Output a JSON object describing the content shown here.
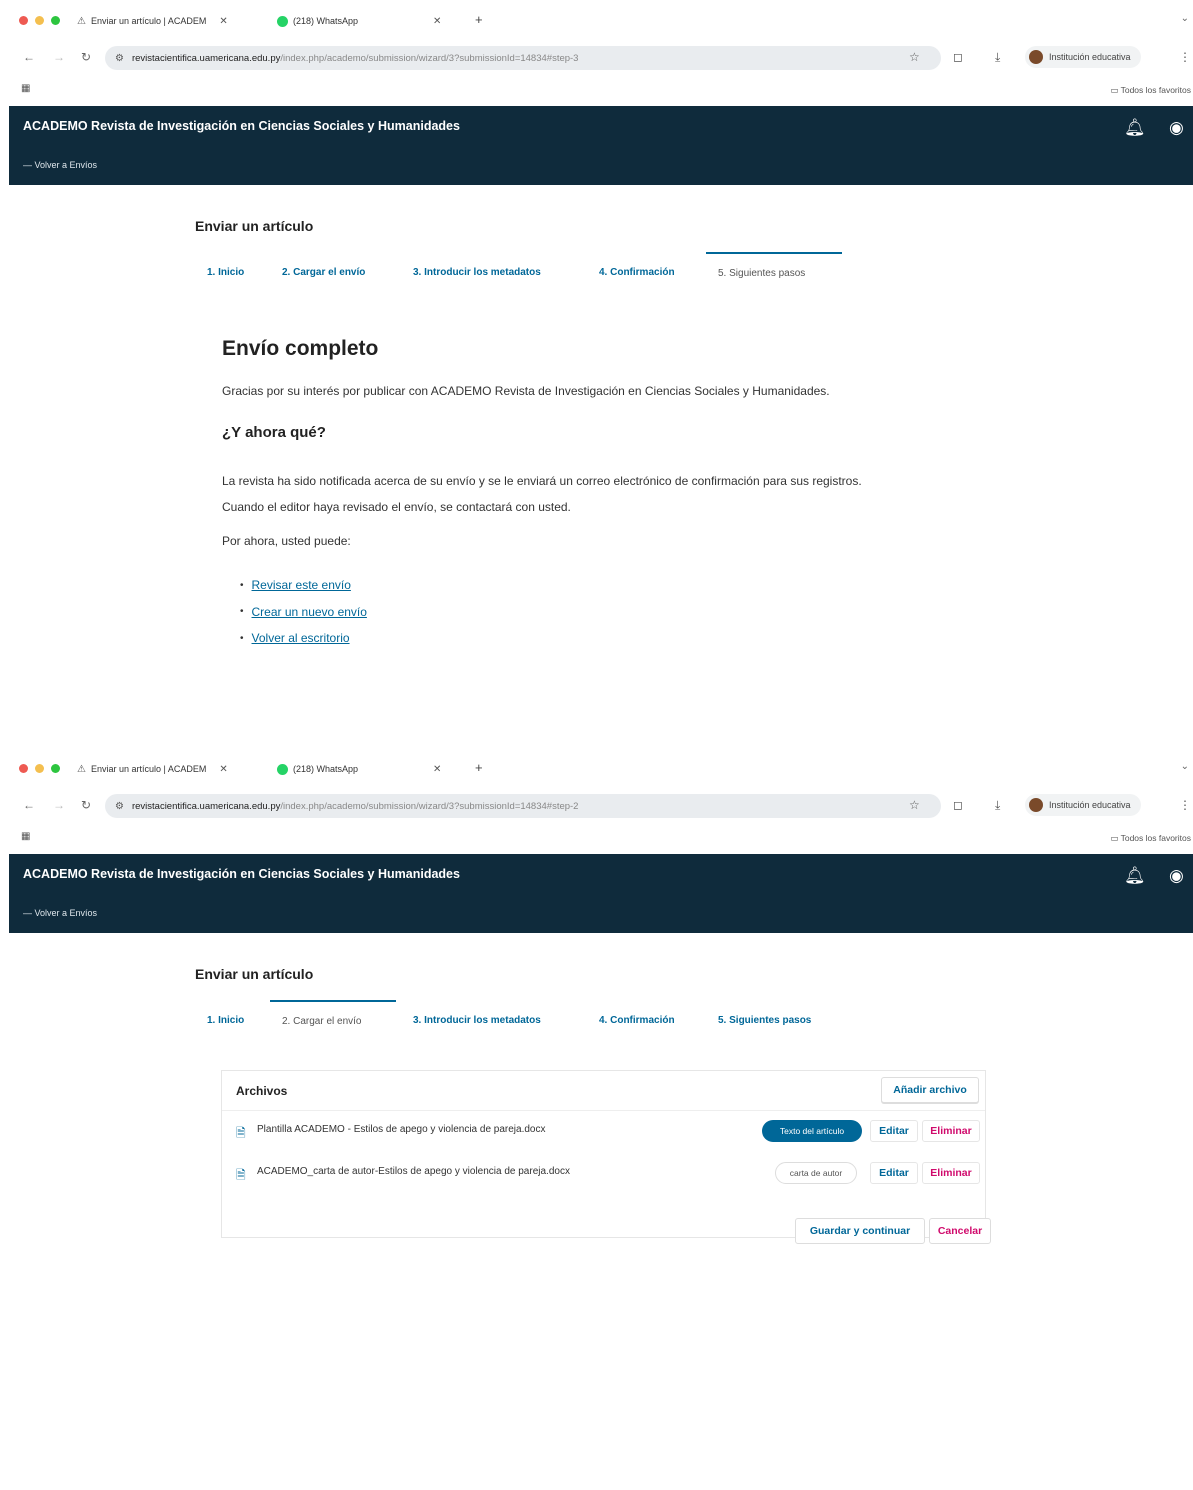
{
  "browser": {
    "tab_active_label": "Enviar un artículo | ACADEM",
    "tab_other_label": "(218) WhatsApp",
    "tab_active_label_2": "Enviar un artículo | ACADEM",
    "tab_other_label_2": "(218) WhatsApp",
    "url_host": "revistacientifica.uamericana.edu.py",
    "url_path_1": "/index.php/academo/submission/wizard/3?submissionId=14834#step-3",
    "url_path_2": "/index.php/academo/submission/wizard/3?submissionId=14834#step-2",
    "profile_label": "Institución educativa",
    "bookmarks_all": "Todos los favoritos"
  },
  "site": {
    "title": "ACADEMO Revista de Investigación en Ciencias Sociales y Humanidades",
    "back_link": "— Volver a Envíos"
  },
  "wizard": {
    "page_title": "Enviar un artículo",
    "tabs": [
      {
        "label": "1. Inicio"
      },
      {
        "label": "2. Cargar el envío"
      },
      {
        "label": "3. Introducir los metadatos"
      },
      {
        "label": "4. Confirmación"
      },
      {
        "label": "5. Siguientes pasos"
      }
    ]
  },
  "complete": {
    "heading": "Envío completo",
    "thanks": "Gracias por su interés por publicar con ACADEMO Revista de Investigación en Ciencias Sociales y Humanidades.",
    "subheading": "¿Y ahora qué?",
    "notified_line1": "La revista ha sido notificada acerca de su envío y se le enviará un correo electrónico de confirmación para sus registros.",
    "notified_line2": "Cuando el editor haya revisado el envío, se contactará con usted.",
    "for_now": "Por ahora, usted puede:",
    "links": [
      "Revisar este envío",
      "Crear un nuevo envío",
      "Volver al escritorio"
    ]
  },
  "upload": {
    "files_title": "Archivos",
    "add_file": "Añadir archivo",
    "files": [
      {
        "name": "Plantilla ACADEMO - Estilos de apego y violencia de pareja.docx",
        "type": "Texto del artículo"
      },
      {
        "name": "ACADEMO_carta de autor-Estilos de apego y violencia de pareja.docx",
        "type": "carta de autor"
      }
    ],
    "edit_label": "Editar",
    "delete_label": "Eliminar",
    "save_continue": "Guardar y continuar",
    "cancel": "Cancelar"
  },
  "colors": {
    "header_bg": "#0f2b3c",
    "link": "#006798",
    "danger": "#d00a6c"
  }
}
